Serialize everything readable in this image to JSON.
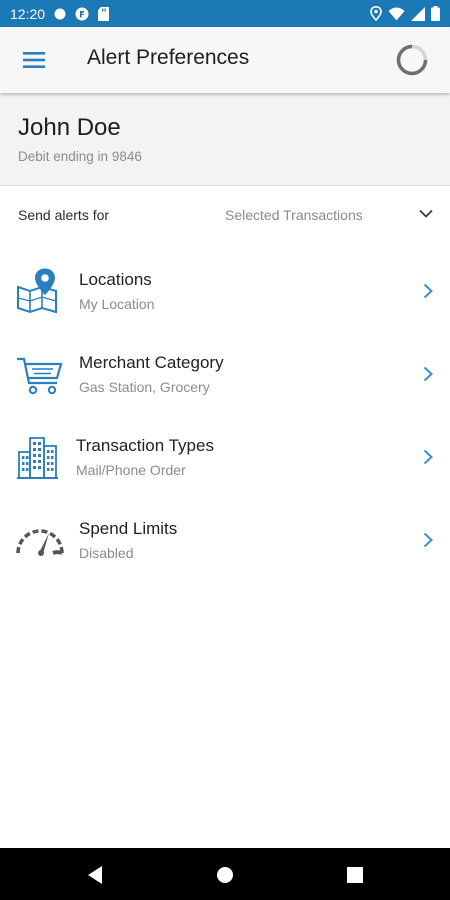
{
  "status_bar": {
    "time": "12:20",
    "left_icons": [
      "notification-dot-icon",
      "app-badge-icon",
      "sd-card-icon"
    ],
    "right_icons": [
      "location-pin-icon",
      "wifi-icon",
      "signal-icon",
      "battery-icon"
    ]
  },
  "app_bar": {
    "title": "Alert Preferences",
    "menu_icon": "hamburger-menu-icon",
    "loading_icon": "loading-spinner-icon"
  },
  "account": {
    "name": "John Doe",
    "card_text": "Debit ending in 9846"
  },
  "send_alerts": {
    "label": "Send alerts for",
    "value": "Selected Transactions",
    "icon": "chevron-down-icon"
  },
  "preferences": [
    {
      "title": "Locations",
      "subtitle": "My Location",
      "icon": "map-location-icon"
    },
    {
      "title": "Merchant Category",
      "subtitle": "Gas Station, Grocery",
      "icon": "shopping-cart-icon"
    },
    {
      "title": "Transaction Types",
      "subtitle": "Mail/Phone Order",
      "icon": "buildings-icon"
    },
    {
      "title": "Spend Limits",
      "subtitle": "Disabled",
      "icon": "speedometer-icon"
    }
  ],
  "nav_bar": {
    "icons": [
      "back-triangle-icon",
      "home-circle-icon",
      "recents-square-icon"
    ]
  },
  "colors": {
    "status_bar": "#1a78b5",
    "accent_blue": "#2a7fc0",
    "icon_gray": "#555555",
    "chevron_blue": "#3a8fd0"
  }
}
